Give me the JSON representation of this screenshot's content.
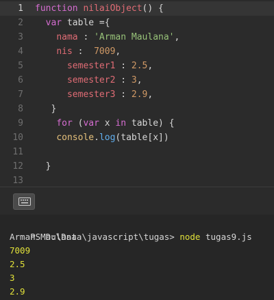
{
  "editor": {
    "active_line": 1,
    "lines": [
      {
        "n": "1",
        "tokens": [
          {
            "t": "function ",
            "c": "kw"
          },
          {
            "t": "nilaiObject",
            "c": "fn"
          },
          {
            "t": "() {",
            "c": "punc"
          }
        ]
      },
      {
        "n": "2",
        "tokens": [
          {
            "t": "  "
          },
          {
            "t": "var",
            "c": "kw"
          },
          {
            "t": " table ={",
            "c": "plain"
          }
        ]
      },
      {
        "n": "3",
        "tokens": [
          {
            "t": "    "
          },
          {
            "t": "nama",
            "c": "prop"
          },
          {
            "t": " : ",
            "c": "punc"
          },
          {
            "t": "'Arman Maulana'",
            "c": "str"
          },
          {
            "t": ",",
            "c": "punc"
          }
        ]
      },
      {
        "n": "4",
        "tokens": [
          {
            "t": "    "
          },
          {
            "t": "nis",
            "c": "prop"
          },
          {
            "t": " :  ",
            "c": "punc"
          },
          {
            "t": "7009",
            "c": "num"
          },
          {
            "t": ",",
            "c": "punc"
          }
        ]
      },
      {
        "n": "5",
        "tokens": [
          {
            "t": "      "
          },
          {
            "t": "semester1",
            "c": "prop"
          },
          {
            "t": " : ",
            "c": "punc"
          },
          {
            "t": "2.5",
            "c": "num"
          },
          {
            "t": ",",
            "c": "punc"
          }
        ]
      },
      {
        "n": "6",
        "tokens": [
          {
            "t": "      "
          },
          {
            "t": "semester2",
            "c": "prop"
          },
          {
            "t": " : ",
            "c": "punc"
          },
          {
            "t": "3",
            "c": "num"
          },
          {
            "t": ",",
            "c": "punc"
          }
        ]
      },
      {
        "n": "7",
        "tokens": [
          {
            "t": "      "
          },
          {
            "t": "semester3",
            "c": "prop"
          },
          {
            "t": " : ",
            "c": "punc"
          },
          {
            "t": "2.9",
            "c": "num"
          },
          {
            "t": ",",
            "c": "punc"
          }
        ]
      },
      {
        "n": "8",
        "tokens": [
          {
            "t": "   "
          },
          {
            "t": "}",
            "c": "punc"
          }
        ]
      },
      {
        "n": "9",
        "tokens": [
          {
            "t": "    "
          },
          {
            "t": "for",
            "c": "kw"
          },
          {
            "t": " (",
            "c": "punc"
          },
          {
            "t": "var",
            "c": "kw"
          },
          {
            "t": " x ",
            "c": "plain"
          },
          {
            "t": "in",
            "c": "kw"
          },
          {
            "t": " table) {",
            "c": "plain"
          }
        ]
      },
      {
        "n": "10",
        "tokens": [
          {
            "t": "    "
          },
          {
            "t": "console",
            "c": "obj"
          },
          {
            "t": ".",
            "c": "punc"
          },
          {
            "t": "log",
            "c": "method"
          },
          {
            "t": "(table[x])",
            "c": "plain"
          }
        ]
      },
      {
        "n": "11",
        "tokens": []
      },
      {
        "n": "12",
        "tokens": [
          {
            "t": "  "
          },
          {
            "t": "}",
            "c": "punc"
          }
        ]
      },
      {
        "n": "13",
        "tokens": []
      }
    ]
  },
  "terminal": {
    "prompt": "PS D:\\Data\\javascript\\tugas> ",
    "command": "node",
    "args": " tugas9.js",
    "output": [
      "Arman Maulana",
      "7009",
      "2.5",
      "3",
      "2.9"
    ],
    "colors": {
      "white": "#d7d7d7",
      "yellow": "#e2e23a"
    },
    "toggle_icon": "keyboard-icon"
  }
}
